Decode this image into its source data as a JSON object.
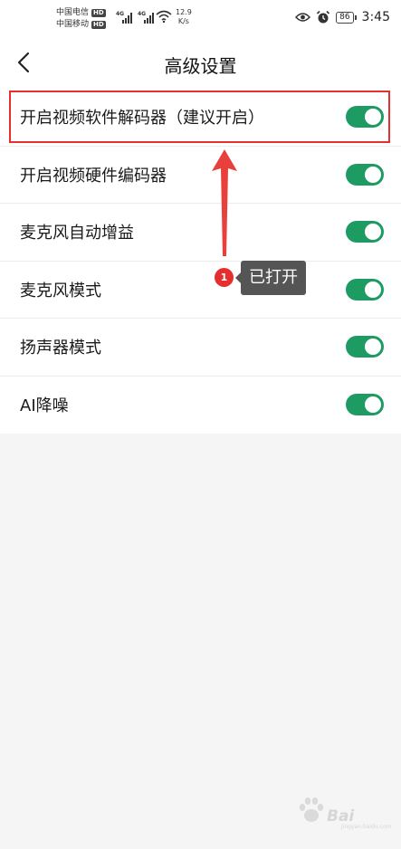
{
  "status_bar": {
    "carrier_1": "中国电信",
    "carrier_2": "中国移动",
    "hd_badge": "HD",
    "network_type": "4G",
    "speed_value": "12.9",
    "speed_unit": "K/s",
    "battery": "86",
    "time": "3:45",
    "icons": [
      "eye-icon",
      "alarm-icon",
      "wifi-icon",
      "signal-icon",
      "battery-icon"
    ]
  },
  "header": {
    "back_icon": "chevron-left-icon",
    "title": "高级设置"
  },
  "settings": [
    {
      "label": "开启视频软件解码器（建议开启）",
      "enabled": true
    },
    {
      "label": "开启视频硬件编码器",
      "enabled": true
    },
    {
      "label": "麦克风自动增益",
      "enabled": true
    },
    {
      "label": "麦克风模式",
      "enabled": true
    },
    {
      "label": "扬声器模式",
      "enabled": true
    },
    {
      "label": "AI降噪",
      "enabled": true
    }
  ],
  "annotation": {
    "number": "1",
    "text": "已打开"
  },
  "watermark": {
    "text": "Bai",
    "sub": "jingyan.baidu.com"
  },
  "colors": {
    "toggle_on": "#1e9b63",
    "highlight": "#e6302f",
    "tooltip_bg": "#555555"
  }
}
